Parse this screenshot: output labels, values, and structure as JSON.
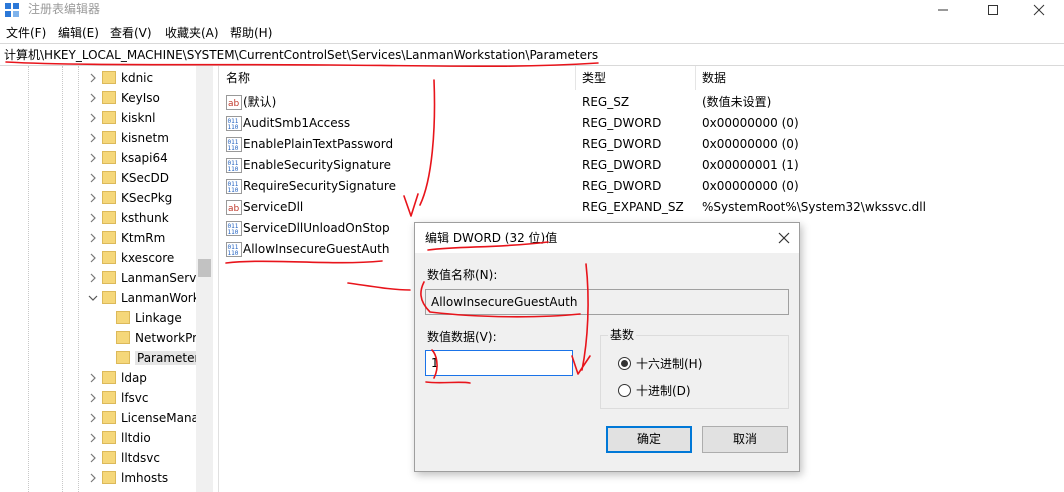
{
  "window": {
    "title": "注册表编辑器",
    "controls": {
      "minimize": "minimize-icon",
      "maximize": "maximize-icon",
      "close": "close-icon"
    }
  },
  "menu": [
    "文件(F)",
    "编辑(E)",
    "查看(V)",
    "收藏夹(A)",
    "帮助(H)"
  ],
  "address": "计算机\\HKEY_LOCAL_MACHINE\\SYSTEM\\CurrentControlSet\\Services\\LanmanWorkstation\\Parameters",
  "tree": {
    "items": [
      {
        "label": "kdnic",
        "expander": true
      },
      {
        "label": "KeyIso",
        "expander": true
      },
      {
        "label": "kisknl",
        "expander": true
      },
      {
        "label": "kisnetm",
        "expander": true
      },
      {
        "label": "ksapi64",
        "expander": true
      },
      {
        "label": "KSecDD",
        "expander": true
      },
      {
        "label": "KSecPkg",
        "expander": true
      },
      {
        "label": "ksthunk",
        "expander": true
      },
      {
        "label": "KtmRm",
        "expander": true
      },
      {
        "label": "kxescore",
        "expander": true
      },
      {
        "label": "LanmanServe",
        "expander": true
      },
      {
        "label": "LanmanWork",
        "expander": "open"
      },
      {
        "label": "Linkage",
        "expander": false,
        "child": true
      },
      {
        "label": "NetworkPr",
        "expander": false,
        "child": true
      },
      {
        "label": "Parameter",
        "expander": false,
        "child": true,
        "selected": true
      },
      {
        "label": "ldap",
        "expander": true
      },
      {
        "label": "lfsvc",
        "expander": true
      },
      {
        "label": "LicenseMana",
        "expander": true
      },
      {
        "label": "lltdio",
        "expander": true
      },
      {
        "label": "lltdsvc",
        "expander": true
      },
      {
        "label": "lmhosts",
        "expander": true
      }
    ]
  },
  "list": {
    "columns": [
      "名称",
      "类型",
      "数据"
    ],
    "rows": [
      {
        "icon": "string-value-icon",
        "name": "(默认)",
        "type": "REG_SZ",
        "data": "(数值未设置)"
      },
      {
        "icon": "binary-value-icon",
        "name": "AuditSmb1Access",
        "type": "REG_DWORD",
        "data": "0x00000000 (0)"
      },
      {
        "icon": "binary-value-icon",
        "name": "EnablePlainTextPassword",
        "type": "REG_DWORD",
        "data": "0x00000000 (0)"
      },
      {
        "icon": "binary-value-icon",
        "name": "EnableSecuritySignature",
        "type": "REG_DWORD",
        "data": "0x00000001 (1)"
      },
      {
        "icon": "binary-value-icon",
        "name": "RequireSecuritySignature",
        "type": "REG_DWORD",
        "data": "0x00000000 (0)"
      },
      {
        "icon": "string-value-icon",
        "name": "ServiceDll",
        "type": "REG_EXPAND_SZ",
        "data": "%SystemRoot%\\System32\\wkssvc.dll"
      },
      {
        "icon": "binary-value-icon",
        "name": "ServiceDllUnloadOnStop",
        "type": "",
        "data": ""
      },
      {
        "icon": "binary-value-icon",
        "name": "AllowInsecureGuestAuth",
        "type": "",
        "data": ""
      }
    ]
  },
  "dialog": {
    "title": "编辑 DWORD (32 位)值",
    "name_label": "数值名称(N):",
    "name_value": "AllowInsecureGuestAuth",
    "data_label": "数值数据(V):",
    "data_value": "1",
    "base_label": "基数",
    "base_options": [
      {
        "label": "十六进制(H)",
        "checked": true
      },
      {
        "label": "十进制(D)",
        "checked": false
      }
    ],
    "ok_label": "确定",
    "cancel_label": "取消"
  },
  "annotation_color": "#e8141b"
}
